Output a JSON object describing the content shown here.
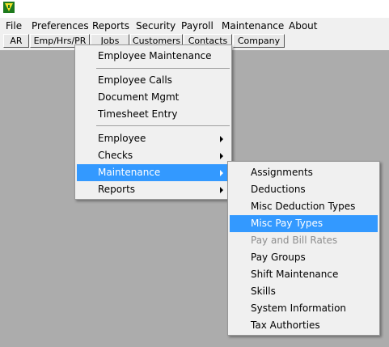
{
  "menubar": [
    "File",
    "Preferences",
    "Reports",
    "Security",
    "Payroll",
    "Maintenance",
    "About"
  ],
  "toolbar": [
    "AR",
    "Emp/Hrs/PR",
    "Jobs",
    "Customers",
    "Contacts",
    "Company"
  ],
  "payroll_menu": {
    "employee_maintenance": "Employee Maintenance",
    "employee_calls": "Employee Calls",
    "document_mgmt": "Document Mgmt",
    "timesheet_entry": "Timesheet Entry",
    "employee": "Employee",
    "checks": "Checks",
    "maintenance": "Maintenance",
    "reports": "Reports"
  },
  "maintenance_submenu": {
    "assignments": "Assignments",
    "deductions": "Deductions",
    "misc_deduction_types": "Misc Deduction Types",
    "misc_pay_types": "Misc Pay Types",
    "pay_and_bill_rates": "Pay and Bill Rates",
    "pay_groups": "Pay Groups",
    "shift_maintenance": "Shift Maintenance",
    "skills": "Skills",
    "system_information": "System Information",
    "tax_authorities": "Tax Authorties"
  },
  "colors": {
    "highlight": "#3399ff",
    "desktop": "#acacac",
    "menu_bg": "#f0f0f0",
    "disabled": "#8d8d8d"
  },
  "icons": {
    "app": "app-logo-icon",
    "submenu_arrow": "submenu-arrow-icon"
  }
}
